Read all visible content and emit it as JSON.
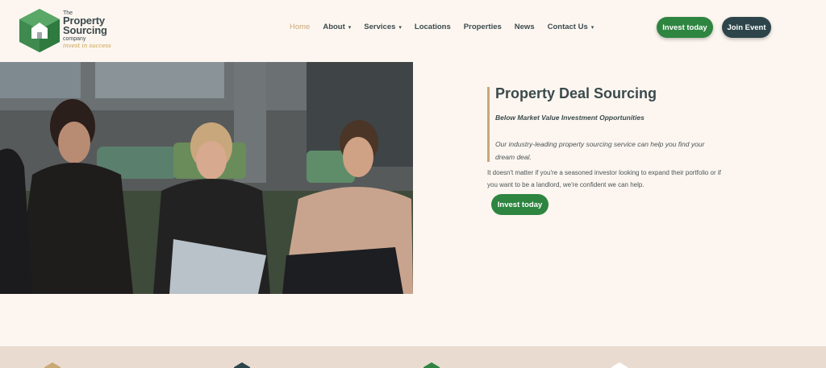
{
  "logo": {
    "the": "The",
    "line1": "Property",
    "line2": "Sourcing",
    "company": "company",
    "tagline": "invest in success",
    "icon": "house-hexagon-icon"
  },
  "nav": {
    "items": [
      {
        "label": "Home",
        "active": true,
        "dropdown": false
      },
      {
        "label": "About",
        "active": false,
        "dropdown": true
      },
      {
        "label": "Services",
        "active": false,
        "dropdown": true
      },
      {
        "label": "Locations",
        "active": false,
        "dropdown": false
      },
      {
        "label": "Properties",
        "active": false,
        "dropdown": false
      },
      {
        "label": "News",
        "active": false,
        "dropdown": false
      },
      {
        "label": "Contact Us",
        "active": false,
        "dropdown": true
      }
    ],
    "chevron": "chevron-down-icon"
  },
  "header_buttons": {
    "invest": "Invest today",
    "join": "Join Event"
  },
  "hero": {
    "title": "Property Deal Sourcing",
    "subtitle": "Below Market Value Investment Opportunities",
    "italic_text": "Our industry-leading property sourcing service can help you find your dream deal.",
    "body_text": "It doesn't matter if you're a seasoned investor looking to expand their portfolio or if you want to be a landlord, we're confident we can help.",
    "button": "Invest today"
  },
  "colors": {
    "background": "#fdf6f0",
    "brand_green": "#2e8540",
    "dark_teal": "#2d454a",
    "gold_accent": "#c9a876",
    "strip": "#eadbd1"
  }
}
